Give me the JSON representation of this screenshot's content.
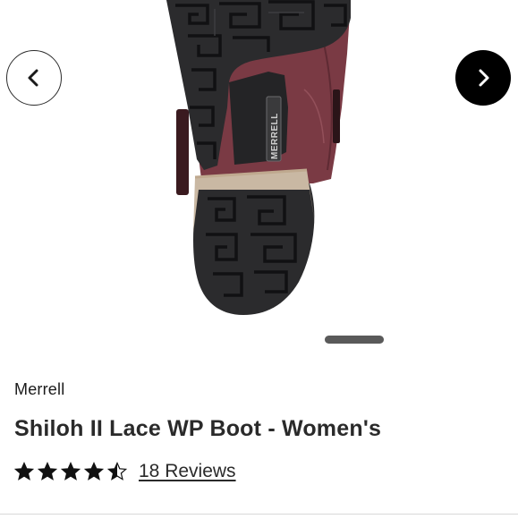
{
  "carousel": {
    "image_alt": "Merrell Shiloh II Lace WP Boot outsole",
    "sole_logo_text": "MERRELL",
    "prev_icon": "chevron-left-icon",
    "next_icon": "chevron-right-icon"
  },
  "product": {
    "brand": "Merrell",
    "title": "Shiloh II Lace WP Boot - Women's",
    "rating": 4.5,
    "rating_max": 5,
    "reviews_label": "18 Reviews"
  },
  "colors": {
    "star": "#111111",
    "next_button_bg": "#000000",
    "sole": "#2b2b2d",
    "upper": "#7a3a44"
  }
}
